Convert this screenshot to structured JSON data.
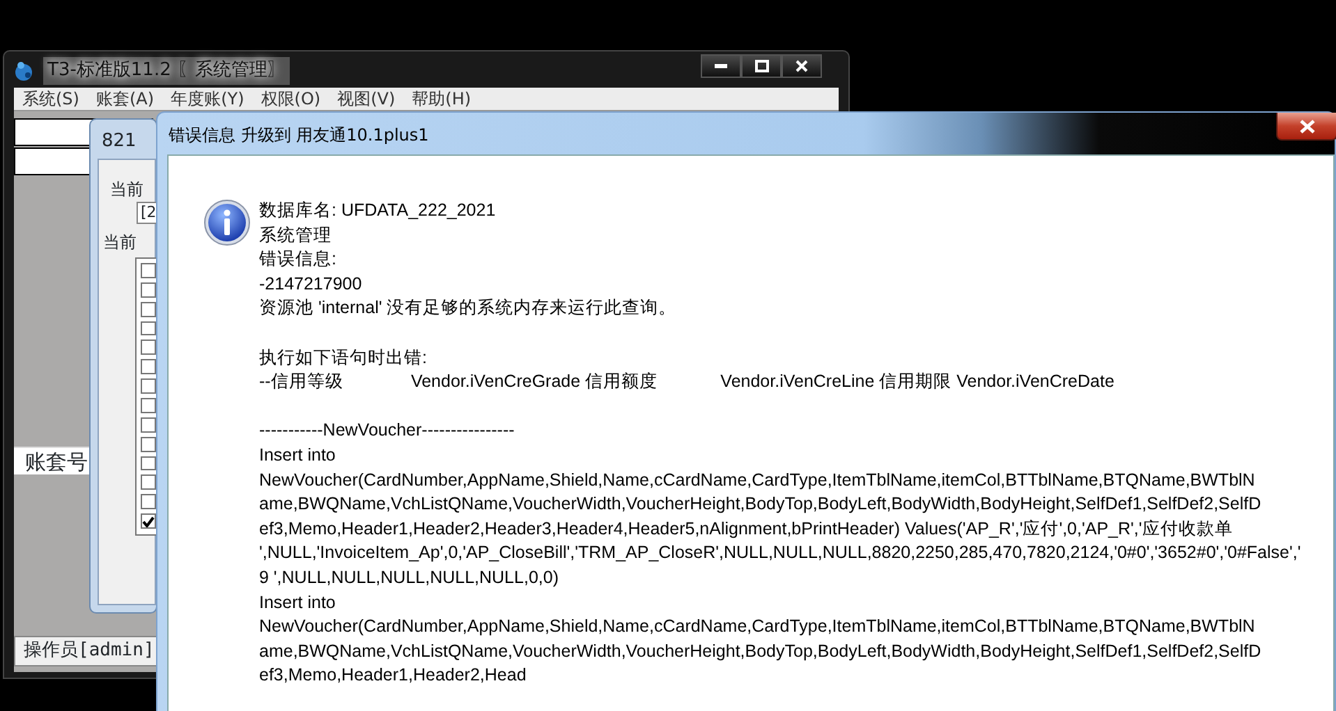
{
  "main_window": {
    "title": "T3-标准版11.2 〖系统管理〗",
    "menu": [
      "系统(S)",
      "账套(A)",
      "年度账(Y)",
      "权限(O)",
      "视图(V)",
      "帮助(H)"
    ],
    "account_label": "账套号",
    "status_bar": "操作员[admin]"
  },
  "dialog": {
    "title": "821",
    "label_1": "当前",
    "field_value": "[2",
    "label_2": "当前",
    "checkboxes": [
      {
        "checked": false
      },
      {
        "checked": false
      },
      {
        "checked": false
      },
      {
        "checked": false
      },
      {
        "checked": false
      },
      {
        "checked": false
      },
      {
        "checked": false
      },
      {
        "checked": false
      },
      {
        "checked": false
      },
      {
        "checked": false
      },
      {
        "checked": false
      },
      {
        "checked": false
      },
      {
        "checked": false
      },
      {
        "checked": true
      }
    ]
  },
  "error_window": {
    "title": "错误信息  升级到 用友通10.1plus1",
    "message_blocks": [
      [
        "数据库名: UFDATA_222_2021",
        "系统管理",
        "错误信息:",
        "-2147217900",
        "资源池 'internal' 没有足够的系统内存来运行此查询。"
      ],
      [
        "执行如下语句时出错:",
        "--信用等级              Vendor.iVenCreGrade 信用额度             Vendor.iVenCreLine 信用期限 Vendor.iVenCreDate"
      ],
      [
        "-----------NewVoucher----------------",
        "Insert into",
        "NewVoucher(CardNumber,AppName,Shield,Name,cCardName,CardType,ItemTblName,itemCol,BTTblName,BTQName,BWTblN",
        "ame,BWQName,VchListQName,VoucherWidth,VoucherHeight,BodyTop,BodyLeft,BodyWidth,BodyHeight,SelfDef1,SelfDef2,SelfD",
        "ef3,Memo,Header1,Header2,Header3,Header4,Header5,nAlignment,bPrintHeader) Values('AP_R','应付',0,'AP_R','应付收款单",
        "',NULL,'InvoiceItem_Ap',0,'AP_CloseBill','TRM_AP_CloseR',NULL,NULL,NULL,8820,2250,285,470,7820,2124,'0#0','3652#0','0#False','",
        "9 ',NULL,NULL,NULL,NULL,NULL,0,0)",
        "Insert into",
        "NewVoucher(CardNumber,AppName,Shield,Name,cCardName,CardType,ItemTblName,itemCol,BTTblName,BTQName,BWTblN",
        "ame,BWQName,VchListQName,VoucherWidth,VoucherHeight,BodyTop,BodyLeft,BodyWidth,BodyHeight,SelfDef1,SelfDef2,SelfD",
        "ef3,Memo,Header1,Header2,Head"
      ]
    ]
  }
}
